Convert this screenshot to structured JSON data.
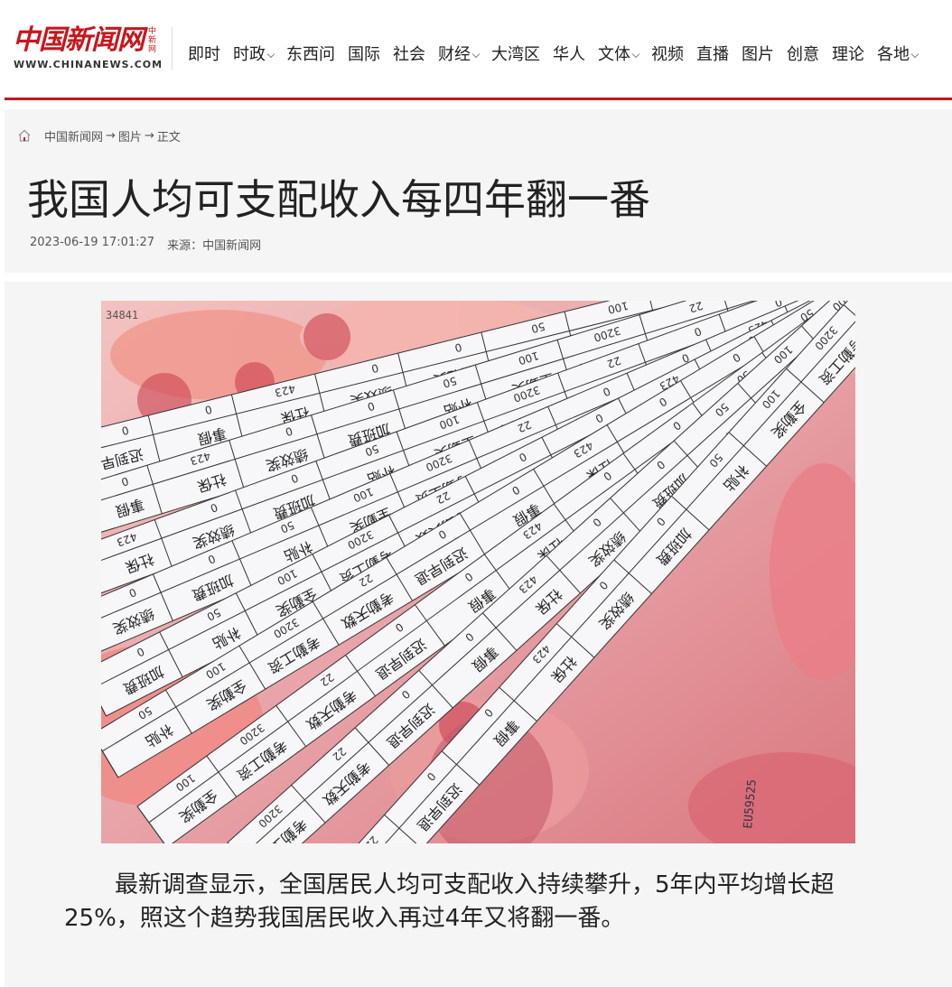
{
  "site": {
    "logo_cn": "中国新闻网",
    "logo_side": "中新网",
    "logo_en": "WWW.CHINANEWS.COM",
    "brand_color": "#c8161d"
  },
  "nav": [
    {
      "label": "即时",
      "dropdown": false
    },
    {
      "label": "时政",
      "dropdown": true
    },
    {
      "label": "东西问",
      "dropdown": false
    },
    {
      "label": "国际",
      "dropdown": false
    },
    {
      "label": "社会",
      "dropdown": false
    },
    {
      "label": "财经",
      "dropdown": true
    },
    {
      "label": "大湾区",
      "dropdown": false
    },
    {
      "label": "华人",
      "dropdown": false
    },
    {
      "label": "文体",
      "dropdown": true
    },
    {
      "label": "视频",
      "dropdown": false
    },
    {
      "label": "直播",
      "dropdown": false
    },
    {
      "label": "图片",
      "dropdown": false
    },
    {
      "label": "创意",
      "dropdown": false
    },
    {
      "label": "理论",
      "dropdown": false
    },
    {
      "label": "各地",
      "dropdown": true
    }
  ],
  "breadcrumb": {
    "home_icon": "home-icon",
    "items": [
      "中国新闻网",
      "图片",
      "正文"
    ],
    "separator": "→"
  },
  "article": {
    "title": "我国人均可支配收入每四年翻一番",
    "datetime": "2023-06-19 17:01:27",
    "source": "来源：中国新闻网",
    "paragraph": "最新调查显示，全国居民人均可支配收入持续攀升，5年内平均增长超25%，照这个趋势我国居民收入再过4年又将翻一番。"
  },
  "photo": {
    "strip_labels": [
      "迟到早退",
      "事假",
      "社保",
      "绩效奖",
      "加班费",
      "补贴",
      "全勤奖",
      "考勤工资",
      "考勤天数"
    ],
    "strip_values": [
      "0",
      "0",
      "423",
      "0",
      "0",
      "50",
      "100",
      "3200",
      "22"
    ]
  }
}
